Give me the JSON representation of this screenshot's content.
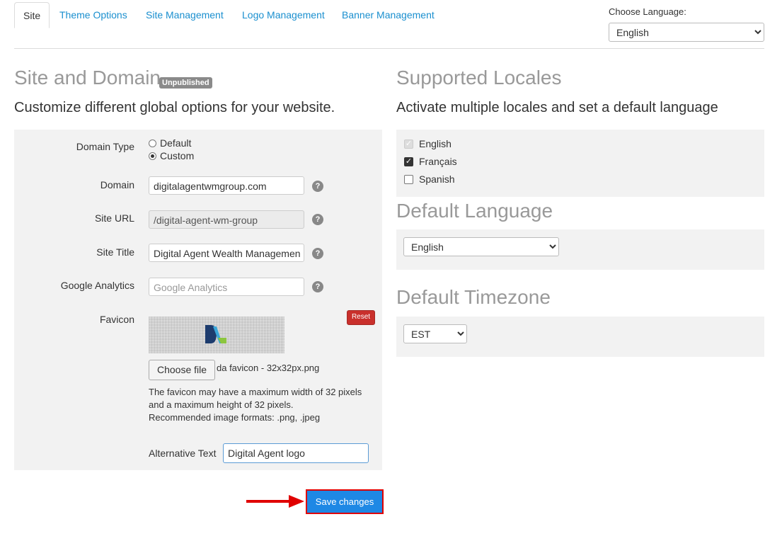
{
  "tabs": [
    {
      "label": "Site",
      "active": true
    },
    {
      "label": "Theme Options"
    },
    {
      "label": "Site Management"
    },
    {
      "label": "Logo Management"
    },
    {
      "label": "Banner Management"
    }
  ],
  "language_chooser": {
    "label": "Choose Language:",
    "selected": "English"
  },
  "site_domain": {
    "title": "Site and Domain",
    "badge": "Unpublished",
    "subtitle": "Customize different global options for your website.",
    "domain_type": {
      "label": "Domain Type",
      "options": [
        "Default",
        "Custom"
      ],
      "selected": "Custom"
    },
    "domain": {
      "label": "Domain",
      "value": "digitalagentwmgroup.com"
    },
    "site_url": {
      "label": "Site URL",
      "value": "/digital-agent-wm-group"
    },
    "site_title": {
      "label": "Site Title",
      "value": "Digital Agent Wealth Managemen"
    },
    "google_analytics": {
      "label": "Google Analytics",
      "placeholder": "Google Analytics"
    },
    "favicon": {
      "label": "Favicon",
      "reset_label": "Reset",
      "choose_file_label": "Choose file",
      "file_name": "da favicon - 32x32px.png",
      "help_lines": [
        "The favicon may have a maximum width of 32 pixels",
        "and a maximum height of 32 pixels.",
        "Recommended image formats: .png, .jpeg"
      ],
      "alt_text_label": "Alternative Text",
      "alt_text_value": "Digital Agent logo"
    },
    "save_label": "Save changes"
  },
  "locales": {
    "title": "Supported Locales",
    "subtitle": "Activate multiple locales and set a default language",
    "items": [
      {
        "label": "English",
        "checked": true,
        "disabled": true
      },
      {
        "label": "Français",
        "checked": true
      },
      {
        "label": "Spanish",
        "checked": false
      }
    ]
  },
  "default_language": {
    "title": "Default Language",
    "selected": "English"
  },
  "default_timezone": {
    "title": "Default Timezone",
    "selected": "EST"
  },
  "help_glyph": "?",
  "check_glyph": "✓",
  "colors": {
    "link": "#1a8fcf",
    "save_button": "#1e88e5",
    "reset_button": "#c9302c",
    "highlight": "#e00000"
  }
}
